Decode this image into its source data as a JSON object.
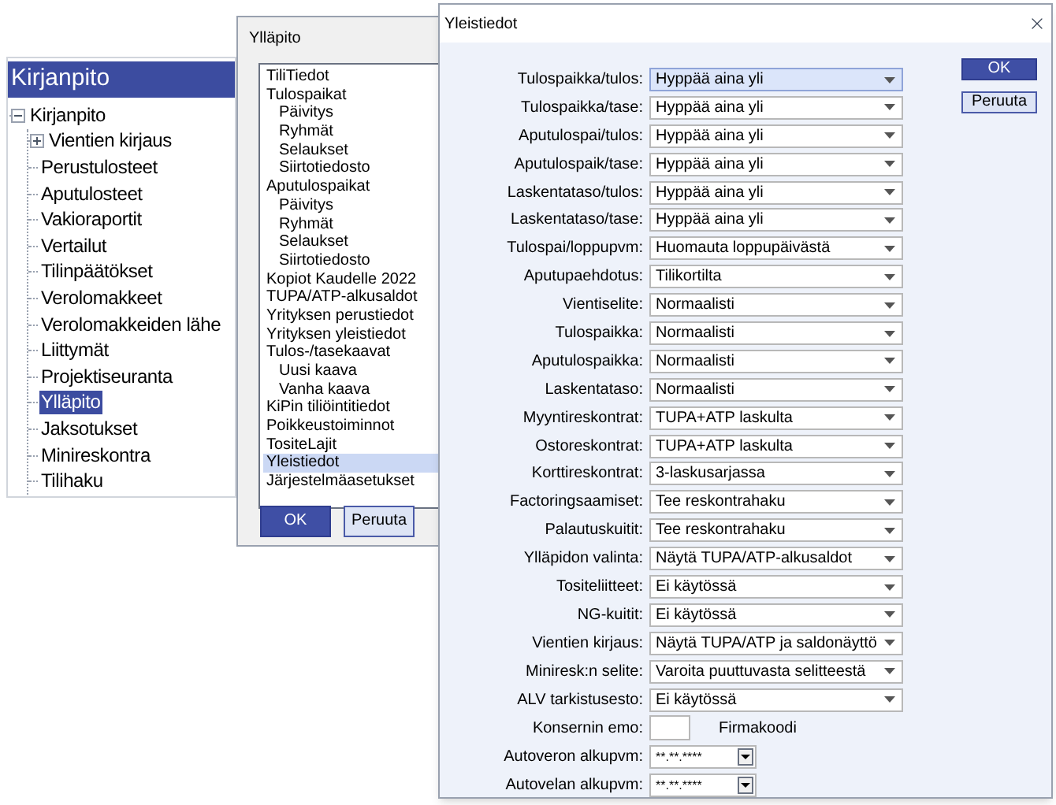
{
  "main_panel": {
    "title": "Kirjanpito",
    "tree": [
      {
        "label": "Kirjanpito",
        "expanded": true,
        "selected": false,
        "children": [
          {
            "label": "Vientien kirjaus",
            "expanded": false,
            "selected": false
          },
          {
            "label": "Perustulosteet",
            "selected": false
          },
          {
            "label": "Aputulosteet",
            "selected": false
          },
          {
            "label": "Vakioraportit",
            "selected": false
          },
          {
            "label": "Vertailut",
            "selected": false
          },
          {
            "label": "Tilinpäätökset",
            "selected": false
          },
          {
            "label": "Verolomakkeet",
            "selected": false
          },
          {
            "label": "Verolomakkeiden lähe",
            "selected": false
          },
          {
            "label": "Liittymät",
            "selected": false
          },
          {
            "label": "Projektiseuranta",
            "selected": false
          },
          {
            "label": "Ylläpito",
            "selected": true
          },
          {
            "label": "Jaksotukset",
            "selected": false
          },
          {
            "label": "Minireskontra",
            "selected": false
          },
          {
            "label": "Tilihaku",
            "selected": false
          }
        ]
      }
    ]
  },
  "maintenance_dialog": {
    "title": "Ylläpito",
    "items": [
      {
        "label": "TiliTiedot",
        "selected": false
      },
      {
        "label": "Tulospaikat",
        "selected": false,
        "children": [
          {
            "label": "Päivitys",
            "selected": false
          },
          {
            "label": "Ryhmät",
            "selected": false
          },
          {
            "label": "Selaukset",
            "selected": false
          },
          {
            "label": "Siirtotiedosto",
            "selected": false
          }
        ]
      },
      {
        "label": "Aputulospaikat",
        "selected": false,
        "children": [
          {
            "label": "Päivitys",
            "selected": false
          },
          {
            "label": "Ryhmät",
            "selected": false
          },
          {
            "label": "Selaukset",
            "selected": false
          },
          {
            "label": "Siirtotiedosto",
            "selected": false
          }
        ]
      },
      {
        "label": "Kopiot Kaudelle 2022",
        "selected": false
      },
      {
        "label": "TUPA/ATP-alkusaldot",
        "selected": false
      },
      {
        "label": "Yrityksen perustiedot",
        "selected": false
      },
      {
        "label": "Yrityksen yleistiedot",
        "selected": false
      },
      {
        "label": "Tulos-/tasekaavat",
        "selected": false,
        "children": [
          {
            "label": "Uusi kaava",
            "selected": false
          },
          {
            "label": "Vanha kaava",
            "selected": false
          }
        ]
      },
      {
        "label": "KiPin tiliöintitiedot",
        "selected": false
      },
      {
        "label": "Poikkeustoiminnot",
        "selected": false
      },
      {
        "label": "TositeLajit",
        "selected": false
      },
      {
        "label": "Yleistiedot",
        "selected": true
      },
      {
        "label": "Järjestelmäasetukset",
        "selected": false
      }
    ],
    "buttons": [
      {
        "label": "OK",
        "kind": "primary"
      },
      {
        "label": "Peruuta",
        "kind": "secondary"
      }
    ]
  },
  "settings_dialog": {
    "title": "Yleistiedot",
    "fields": [
      {
        "label": "Tulospaikka/tulos:",
        "value": "Hyppää aina yli",
        "focused": true
      },
      {
        "label": "Tulospaikka/tase:",
        "value": "Hyppää aina yli",
        "focused": false
      },
      {
        "label": "Aputulospai/tulos:",
        "value": "Hyppää aina yli",
        "focused": false
      },
      {
        "label": "Aputulospaik/tase:",
        "value": "Hyppää aina yli",
        "focused": false
      },
      {
        "label": "Laskentataso/tulos:",
        "value": "Hyppää aina yli",
        "focused": false
      },
      {
        "label": "Laskentataso/tase:",
        "value": "Hyppää aina yli",
        "focused": false
      },
      {
        "label": "Tulospai/loppupvm:",
        "value": "Huomauta loppupäivästä",
        "focused": false
      },
      {
        "label": "Aputupaehdotus:",
        "value": "Tilikortilta",
        "focused": false
      },
      {
        "label": "Vientiselite:",
        "value": "Normaalisti",
        "focused": false
      },
      {
        "label": "Tulospaikka:",
        "value": "Normaalisti",
        "focused": false
      },
      {
        "label": "Aputulospaikka:",
        "value": "Normaalisti",
        "focused": false
      },
      {
        "label": "Laskentataso:",
        "value": "Normaalisti",
        "focused": false
      },
      {
        "label": "Myyntireskontrat:",
        "value": "TUPA+ATP laskulta",
        "focused": false
      },
      {
        "label": "Ostoreskontrat:",
        "value": "TUPA+ATP laskulta",
        "focused": false
      },
      {
        "label": "Korttireskontrat:",
        "value": "3-laskusarjassa",
        "focused": false
      },
      {
        "label": "Factoringsaamiset:",
        "value": "Tee reskontrahaku",
        "focused": false
      },
      {
        "label": "Palautuskuitit:",
        "value": "Tee reskontrahaku",
        "focused": false
      },
      {
        "label": "Ylläpidon valinta:",
        "value": "Näytä TUPA/ATP-alkusaldot",
        "focused": false
      },
      {
        "label": "Tositeliitteet:",
        "value": "Ei käytössä",
        "focused": false
      },
      {
        "label": "NG-kuitit:",
        "value": "Ei käytössä",
        "focused": false
      },
      {
        "label": "Vientien kirjaus:",
        "value": "Näytä TUPA/ATP ja saldonäyttö",
        "focused": false
      },
      {
        "label": "Miniresk:n selite:",
        "value": "Varoita puuttuvasta selitteestä",
        "focused": false
      },
      {
        "label": "ALV tarkistusesto:",
        "value": "Ei käytössä",
        "focused": false
      }
    ],
    "parent_company": {
      "label": "Konsernin emo:",
      "note": "Firmakoodi"
    },
    "date_fields": [
      {
        "label": "Autoveron alkupvm:",
        "value": "**.**.****"
      },
      {
        "label": "Autovelan alkupvm:",
        "value": "**.**.****"
      }
    ],
    "buttons": [
      {
        "label": "OK",
        "kind": "primary"
      },
      {
        "label": "Peruuta",
        "kind": "secondary"
      }
    ]
  }
}
